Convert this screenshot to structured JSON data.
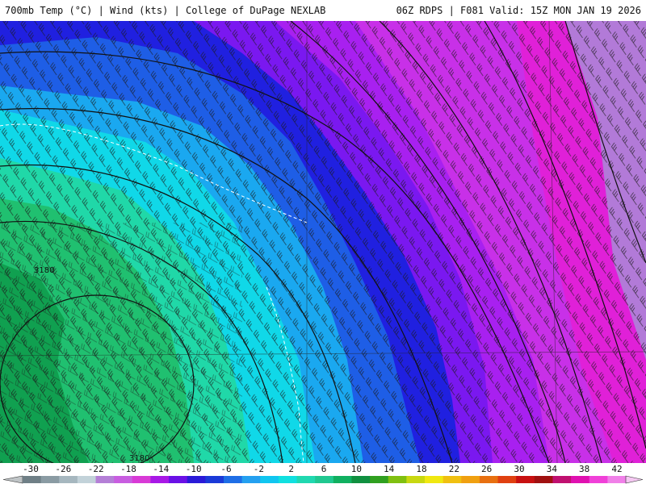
{
  "header": {
    "left_title": "700mb Temp (°C) | Wind (kts) | College of DuPage NEXLAB",
    "right_title": "06Z RDPS | F081 Valid: 15Z MON JAN 19 2026"
  },
  "map": {
    "contour_labels": [
      "3180",
      "3180"
    ]
  },
  "legend": {
    "ticks": [
      "-30",
      "-26",
      "-22",
      "-18",
      "-14",
      "-10",
      "-6",
      "-2",
      "2",
      "6",
      "10",
      "14",
      "18",
      "22",
      "26",
      "30",
      "34",
      "38",
      "42"
    ],
    "colors": [
      "#6f7f86",
      "#8a9ba3",
      "#a6b7bf",
      "#c2d2d9",
      "#b47fd6",
      "#c85de0",
      "#d83ad6",
      "#a818e6",
      "#6a10e6",
      "#2a1ad8",
      "#1a3ad8",
      "#1e6ee6",
      "#24a0f0",
      "#10c6f0",
      "#10e0e0",
      "#20d8b0",
      "#20c890",
      "#10b060",
      "#109040",
      "#30a020",
      "#80c010",
      "#c8d810",
      "#f0e810",
      "#f0c010",
      "#f0a010",
      "#e87010",
      "#e04010",
      "#c81010",
      "#a01010",
      "#c01070",
      "#e010b0",
      "#f040d8",
      "#f080e8"
    ]
  }
}
